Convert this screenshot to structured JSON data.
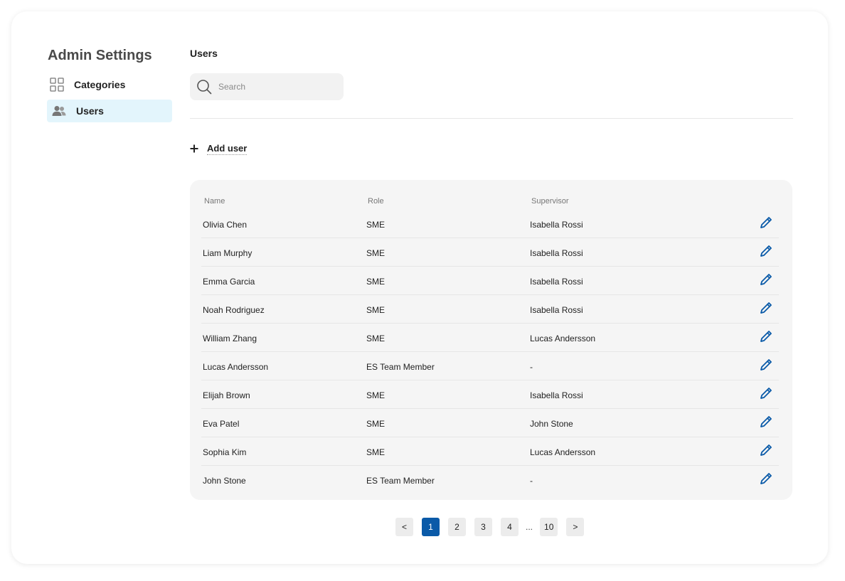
{
  "sidebar": {
    "title": "Admin Settings",
    "items": [
      {
        "label": "Categories",
        "icon": "grid-icon",
        "active": false
      },
      {
        "label": "Users",
        "icon": "users-icon",
        "active": true
      }
    ]
  },
  "main": {
    "title": "Users",
    "search": {
      "placeholder": "Search",
      "value": ""
    },
    "add_user_label": "Add user",
    "add_user_icon": "plus-icon"
  },
  "table": {
    "columns": {
      "name": "Name",
      "role": "Role",
      "supervisor": "Supervisor"
    },
    "rows": [
      {
        "name": "Olivia Chen",
        "role": "SME",
        "supervisor": "Isabella Rossi"
      },
      {
        "name": "Liam Murphy",
        "role": "SME",
        "supervisor": "Isabella Rossi"
      },
      {
        "name": "Emma Garcia",
        "role": "SME",
        "supervisor": "Isabella Rossi"
      },
      {
        "name": "Noah Rodriguez",
        "role": "SME",
        "supervisor": "Isabella Rossi"
      },
      {
        "name": "William Zhang",
        "role": "SME",
        "supervisor": "Lucas Andersson"
      },
      {
        "name": "Lucas Andersson",
        "role": "ES Team Member",
        "supervisor": "-"
      },
      {
        "name": "Elijah Brown",
        "role": "SME",
        "supervisor": "Isabella Rossi"
      },
      {
        "name": "Eva Patel",
        "role": "SME",
        "supervisor": "John Stone"
      },
      {
        "name": "Sophia Kim",
        "role": "SME",
        "supervisor": "Lucas Andersson"
      },
      {
        "name": "John Stone",
        "role": "ES Team Member",
        "supervisor": "-"
      }
    ],
    "row_action_icon": "pencil-icon"
  },
  "pagination": {
    "prev": "<",
    "pages": [
      "1",
      "2",
      "3",
      "4"
    ],
    "ellipsis": "...",
    "last": "10",
    "next": ">",
    "current": "1"
  },
  "colors": {
    "accent": "#0a5aa8",
    "active_nav_bg": "#e3f5fc",
    "table_bg": "#f5f5f5"
  }
}
